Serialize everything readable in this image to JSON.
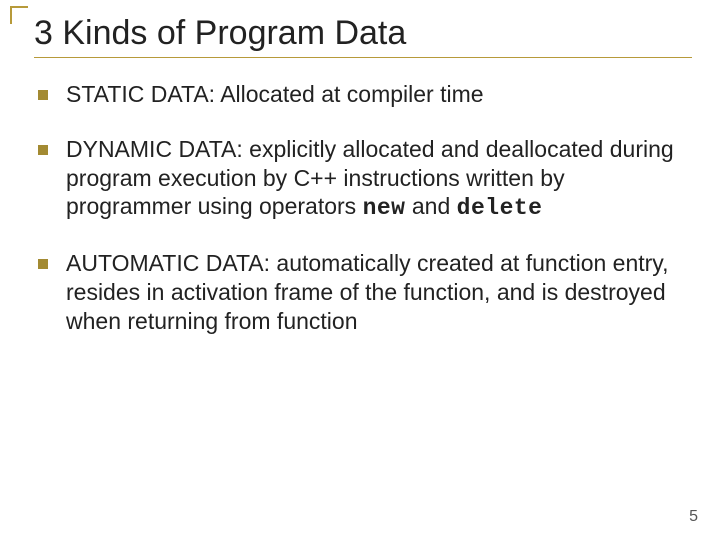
{
  "title": "3 Kinds of Program Data",
  "bullets": [
    {
      "lead": "STATIC DATA: ",
      "rest": "Allocated at compiler time"
    },
    {
      "lead": "DYNAMIC DATA:  ",
      "rest_a": "explicitly allocated and deallocated during program execution by C++ instructions written by programmer using operators ",
      "kw1": "new",
      "mid": " and ",
      "kw2": "delete"
    },
    {
      "lead": "AUTOMATIC DATA: ",
      "rest": "automatically created at function entry, resides in activation frame of the function, and is destroyed when returning from function"
    }
  ],
  "page_number": "5"
}
